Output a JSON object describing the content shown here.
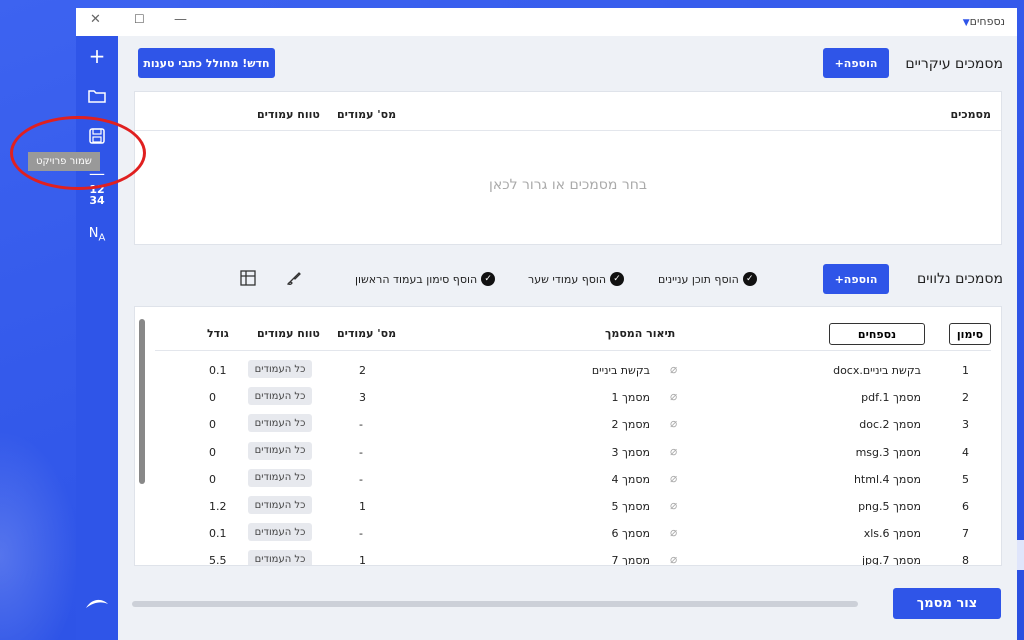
{
  "app": {
    "title": "נספחים"
  },
  "window": {
    "close": "✕",
    "maximize": "☐",
    "minimize": "—"
  },
  "sidebar": {
    "tooltip": "שמור פרויקט",
    "numbers_top": "12",
    "numbers_bottom": "34",
    "na_label": "NA"
  },
  "main_docs": {
    "title": "מסמכים עיקריים",
    "add_button": "הוספה+",
    "new_button": "חדש! מחולל כתבי טענות",
    "col_docs": "מסמכים",
    "col_pages": "מס' עמודים",
    "col_range": "טווח עמודים",
    "empty_text": "בחר מסמכים או גרור לכאן"
  },
  "attached": {
    "title": "מסמכים נלווים",
    "add_button": "הוספה+",
    "options": [
      "הוסף תוכן עניינים",
      "הוסף עמודי שער",
      "הוסף סימון בעמוד הראשון"
    ],
    "col_mark": "סימון",
    "col_appendix": "נספחים",
    "col_desc": "תיאור המסמך",
    "col_pages": "מס' עמודים",
    "col_range": "טווח עמודים",
    "col_size": "גודל",
    "rows": [
      {
        "n": "1",
        "file": "בקשת ביניים.docx",
        "desc": "בקשת ביניים",
        "pages": "2",
        "range": "כל העמודים",
        "size": "0.1"
      },
      {
        "n": "2",
        "file": "מסמך 1.pdf",
        "desc": "מסמך 1",
        "pages": "3",
        "range": "כל העמודים",
        "size": "0"
      },
      {
        "n": "3",
        "file": "מסמך 2.doc",
        "desc": "מסמך 2",
        "pages": "-",
        "range": "כל העמודים",
        "size": "0"
      },
      {
        "n": "4",
        "file": "מסמך 3.msg",
        "desc": "מסמך 3",
        "pages": "-",
        "range": "כל העמודים",
        "size": "0"
      },
      {
        "n": "5",
        "file": "מסמך 4.html",
        "desc": "מסמך 4",
        "pages": "-",
        "range": "כל העמודים",
        "size": "0"
      },
      {
        "n": "6",
        "file": "מסמך 5.png",
        "desc": "מסמך 5",
        "pages": "1",
        "range": "כל העמודים",
        "size": "1.2"
      },
      {
        "n": "7",
        "file": "מסמך 6.xls",
        "desc": "מסמך 6",
        "pages": "-",
        "range": "כל העמודים",
        "size": "0.1"
      },
      {
        "n": "8",
        "file": "מסמך 7.jpg",
        "desc": "מסמך 7",
        "pages": "1",
        "range": "כל העמודים",
        "size": "5.5"
      }
    ]
  },
  "footer": {
    "create_button": "צור מסמך"
  },
  "colors": {
    "brand": "#2f55e8",
    "annotation": "#e02020"
  }
}
